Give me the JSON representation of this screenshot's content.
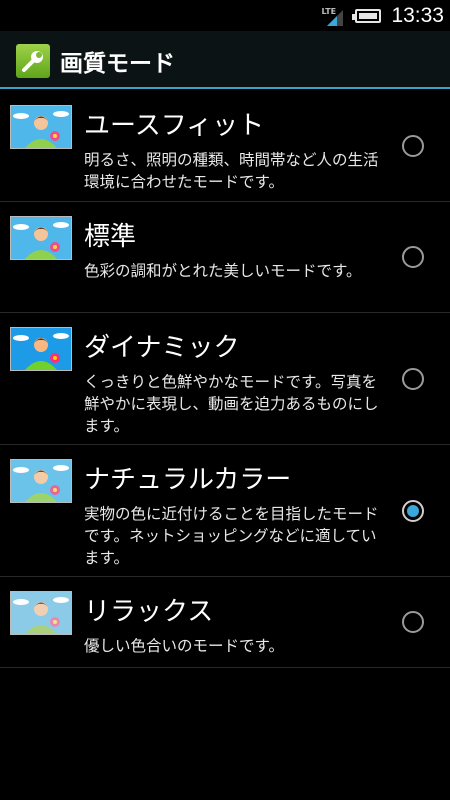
{
  "status": {
    "network": "LTE",
    "time": "13:33"
  },
  "header": {
    "title": "画質モード",
    "icon": "wrench-icon"
  },
  "colors": {
    "accent": "#3aa8d8",
    "background": "#000000",
    "action_bar": "#0c1315"
  },
  "modes": [
    {
      "title": "ユースフィット",
      "desc": "明るさ、照明の種類、時間帯など人の生活環境に合わせたモードです。",
      "selected": false
    },
    {
      "title": "標準",
      "desc": "色彩の調和がとれた美しいモードです。",
      "selected": false
    },
    {
      "title": "ダイナミック",
      "desc": "くっきりと色鮮やかなモードです。写真を鮮やかに表現し、動画を迫力あるものにします。",
      "selected": false
    },
    {
      "title": "ナチュラルカラー",
      "desc": "実物の色に近付けることを目指したモードです。ネットショッピングなどに適しています。",
      "selected": true
    },
    {
      "title": "リラックス",
      "desc": "優しい色合いのモードです。",
      "selected": false
    }
  ]
}
